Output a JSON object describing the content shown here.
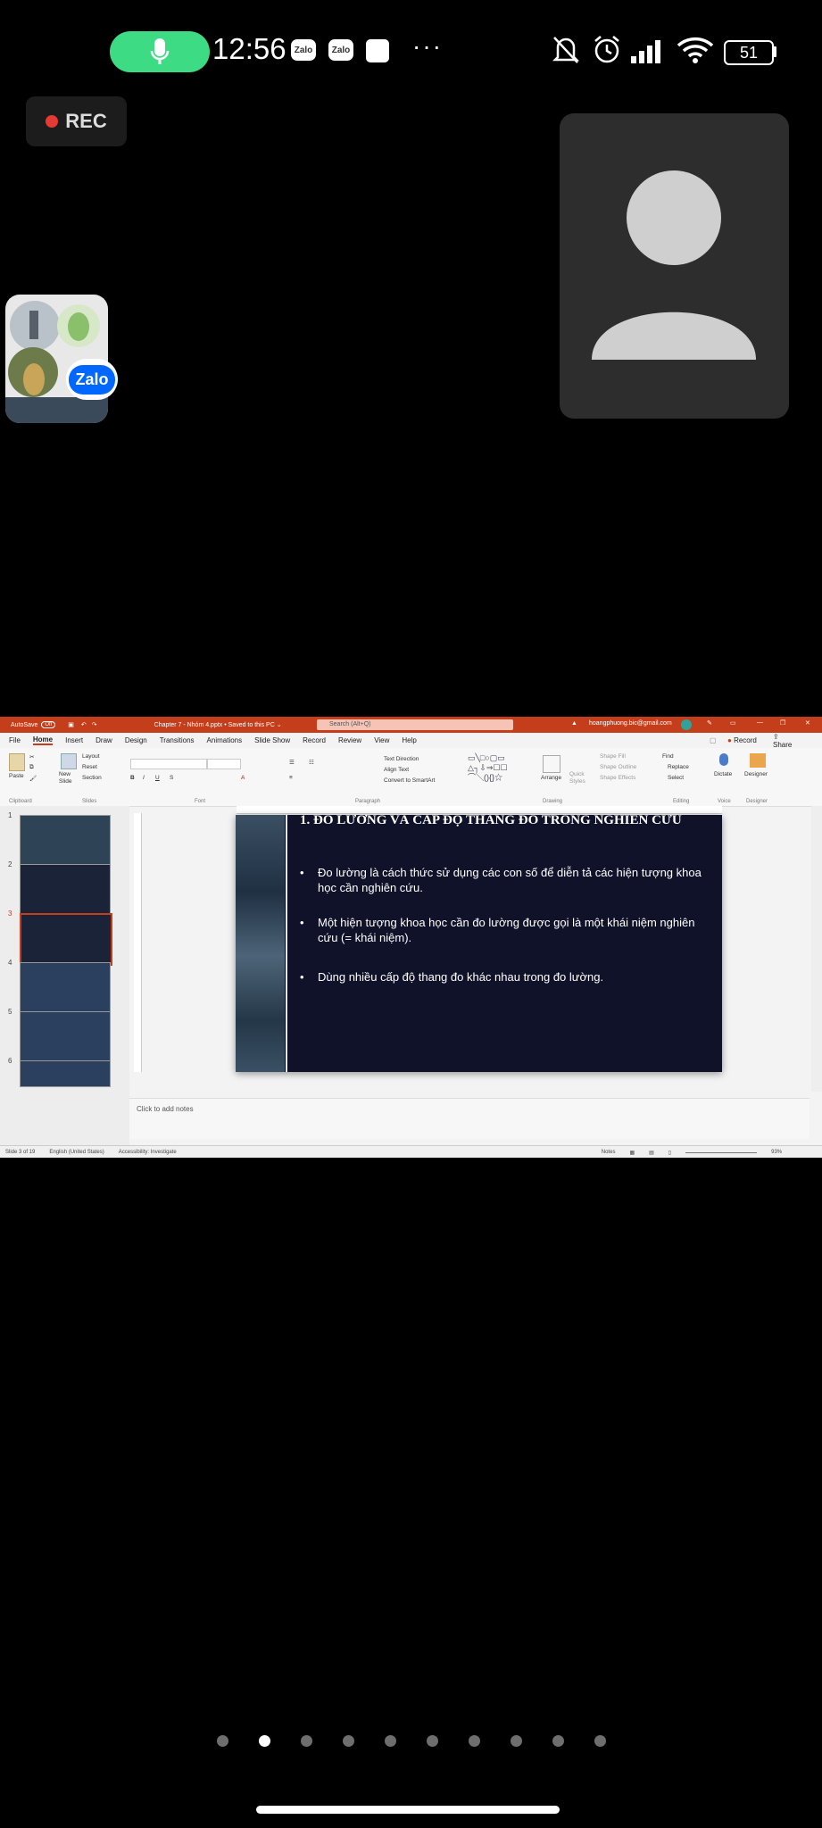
{
  "status_bar": {
    "time": "12:56",
    "zalo_icon_1": "Zalo",
    "zalo_icon_2": "Zalo",
    "more": "···",
    "battery": "51"
  },
  "call": {
    "rec_label": "REC",
    "bubble_badge": "Zalo"
  },
  "ppt": {
    "autosave": "AutoSave",
    "autosave_state": "Off",
    "doc_title": "Chapter 7 - Nhóm 4.pptx • Saved to this PC ⌄",
    "search_placeholder": "Search (Alt+Q)",
    "account": "hoangphuong.bic@gmail.com",
    "menu": [
      "File",
      "Home",
      "Insert",
      "Draw",
      "Design",
      "Transitions",
      "Animations",
      "Slide Show",
      "Record",
      "Review",
      "View",
      "Help"
    ],
    "record_btn": "Record",
    "share_btn": "Share",
    "ribbon": {
      "paste": "Paste",
      "new_slide": "New Slide",
      "layout": "Layout",
      "reset": "Reset",
      "section": "Section",
      "text_direction": "Text Direction",
      "align_text": "Align Text",
      "convert_smartart": "Convert to SmartArt",
      "arrange": "Arrange",
      "quick_styles": "Quick Styles",
      "shape_fill": "Shape Fill",
      "shape_outline": "Shape Outline",
      "shape_effects": "Shape Effects",
      "find": "Find",
      "replace": "Replace",
      "select": "Select",
      "dictate": "Dictate",
      "designer": "Designer",
      "groups": [
        "Clipboard",
        "Slides",
        "Font",
        "Paragraph",
        "Drawing",
        "Editing",
        "Voice",
        "Designer"
      ]
    },
    "thumb_numbers": [
      "1",
      "2",
      "3",
      "4",
      "5",
      "6"
    ],
    "slide": {
      "title": "1. ĐO LƯỜNG VÀ CẤP ĐỘ THANG ĐO TRONG NGHIÊN CỨU",
      "bullets": [
        "Đo lường là cách thức sử dụng các con số để diễn tả các hiện tượng khoa học cần nghiên cứu.",
        "Một hiện tượng khoa học cần đo lường được gọi là một khái niệm nghiên cứu (= khái niệm).",
        "Dùng nhiều cấp độ thang đo khác nhau trong đo lường."
      ]
    },
    "notes_placeholder": "Click to add notes",
    "statusbar": {
      "slide_of": "Slide 3 of 19",
      "language": "English (United States)",
      "accessibility": "Accessibility: Investigate",
      "notes": "Notes",
      "zoom": "93%"
    }
  },
  "pager": {
    "count": 10,
    "active_index": 1
  }
}
